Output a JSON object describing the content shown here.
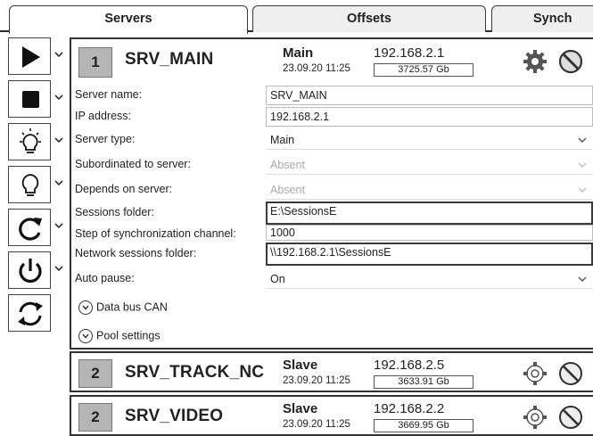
{
  "tabs": [
    {
      "label": "Servers",
      "active": true
    },
    {
      "label": "Offsets",
      "active": false
    },
    {
      "label": "Synch",
      "active": false
    }
  ],
  "toolbar": {
    "items": [
      {
        "icon": "play-icon"
      },
      {
        "icon": "stop-icon"
      },
      {
        "icon": "bulb-on-icon"
      },
      {
        "icon": "bulb-off-icon"
      },
      {
        "icon": "restart-icon"
      },
      {
        "icon": "power-icon"
      },
      {
        "icon": "sync-icon"
      }
    ]
  },
  "main_server": {
    "number": "1",
    "name": "SRV_MAIN",
    "role": "Main",
    "date": "23.09.20 11:25",
    "ip": "192.168.2.1",
    "size": "3725.57 Gb",
    "fields": [
      {
        "label": "Server name:",
        "value": "SRV_MAIN"
      },
      {
        "label": "IP address:",
        "value": "192.168.2.1"
      },
      {
        "label": "Server type:",
        "value": "Main"
      },
      {
        "label": "Subordinated to server:",
        "value": "Absent"
      },
      {
        "label": "Depends on server:",
        "value": "Absent"
      },
      {
        "label": "Sessions folder:",
        "value": "E:\\SessionsE"
      },
      {
        "label": "Step of synchronization channel:",
        "value": "1000"
      },
      {
        "label": "Network sessions folder:",
        "value": "\\\\192.168.2.1\\SessionsE"
      },
      {
        "label": "Auto pause:",
        "value": "On"
      }
    ],
    "expanders": [
      {
        "label": "Data bus CAN"
      },
      {
        "label": "Pool settings"
      }
    ]
  },
  "servers": [
    {
      "number": "2",
      "name": "SRV_TRACK_NC",
      "role": "Slave",
      "date": "23.09.20 11:25",
      "ip": "192.168.2.5",
      "size": "3633.91 Gb"
    },
    {
      "number": "2",
      "name": "SRV_VIDEO",
      "role": "Slave",
      "date": "23.09.20 11:25",
      "ip": "192.168.2.2",
      "size": "3669.95 Gb"
    }
  ]
}
